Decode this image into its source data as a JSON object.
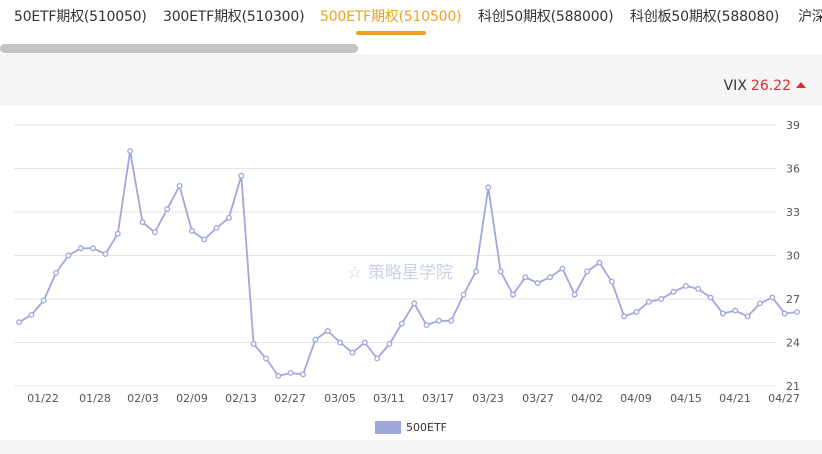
{
  "tabs": [
    {
      "label": "50ETF期权(510050)"
    },
    {
      "label": "300ETF期权(510300)"
    },
    {
      "label": "500ETF期权(510500)"
    },
    {
      "label": "科创50期权(588000)"
    },
    {
      "label": "科创板50期权(588080)"
    },
    {
      "label": "沪深"
    }
  ],
  "active_tab": 2,
  "vix": {
    "label": "VIX",
    "value": "26.22",
    "trend": "up"
  },
  "colors": {
    "accent": "#f0a020",
    "up": "#e22b2b",
    "series": "#a0a7dc"
  },
  "watermark": "策略星学院",
  "chart_data": {
    "type": "line",
    "x_ticks": [
      "01/22",
      "01/28",
      "02/03",
      "02/09",
      "02/13",
      "02/27",
      "03/05",
      "03/11",
      "03/17",
      "03/23",
      "03/27",
      "04/02",
      "04/09",
      "04/15",
      "04/21",
      "04/27"
    ],
    "y_ticks": [
      21,
      24,
      27,
      30,
      33,
      36,
      39
    ],
    "ylim": [
      21,
      39
    ],
    "legend_position": "bottom",
    "grid": "horizontal",
    "series": [
      {
        "name": "500ETF",
        "values": [
          25.4,
          25.9,
          26.9,
          28.8,
          30.0,
          30.5,
          30.5,
          30.1,
          31.5,
          37.2,
          32.3,
          31.6,
          33.2,
          34.8,
          31.7,
          31.1,
          31.9,
          32.6,
          35.5,
          23.9,
          22.9,
          21.7,
          21.9,
          21.8,
          24.2,
          24.8,
          24.0,
          23.3,
          24.0,
          22.9,
          23.9,
          25.3,
          26.7,
          25.2,
          25.5,
          25.5,
          27.3,
          28.9,
          34.7,
          28.9,
          27.3,
          28.5,
          28.1,
          28.5,
          29.1,
          27.3,
          28.9,
          29.5,
          28.2,
          25.8,
          26.1,
          26.8,
          27.0,
          27.5,
          27.9,
          27.7,
          27.1,
          26.0,
          26.2,
          25.8,
          26.7,
          27.1,
          26.0,
          26.1
        ]
      }
    ]
  }
}
